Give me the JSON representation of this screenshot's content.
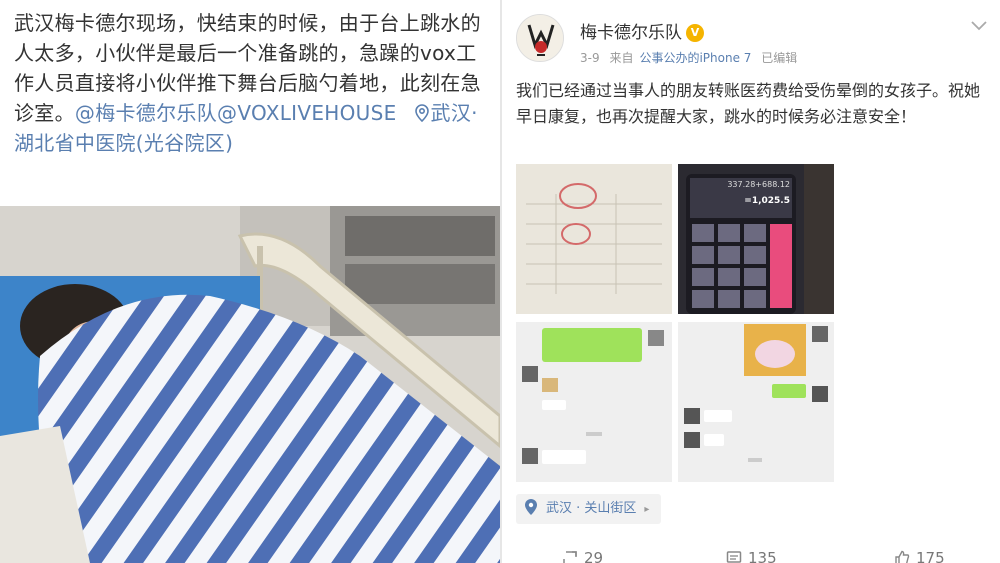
{
  "left_post": {
    "text_main": "武汉梅卡德尔现场，快结束的时候，由于台上跳水的人太多，小伙伴是最后一个准备跳的，急躁的vox工作人员直接将小伙伴推下舞台后脑勺着地，此刻在急诊室。",
    "mention_1": "@梅卡德尔乐队",
    "mention_2": "@VOXLIVEHOUSE",
    "location": "武汉·湖北省中医院(光谷院区)"
  },
  "right_post": {
    "author": "梅卡德尔乐队",
    "vip_badge": "V",
    "date": "3-9",
    "source_prefix": "来自",
    "source_device": "公事公办的iPhone 7",
    "edited": "已编辑",
    "text": "我们已经通过当事人的朋友转账医药费给受伤晕倒的女孩子。祝她早日康复，也再次提醒大家，跳水的时候务必注意安全！",
    "calculator_display": "337.28+688.12",
    "calculator_result": "=1,025.5",
    "location": "武汉 · 关山街区",
    "actions": {
      "repost_count": "29",
      "comment_count": "135",
      "like_count": "175"
    }
  },
  "colors": {
    "link": "#5a7fb0",
    "meta": "#999999",
    "calc_pink": "#e94c7d",
    "chat_green": "#9fe25b"
  },
  "icons": [
    "location-pin-icon",
    "chevron-down-icon",
    "repost-icon",
    "comment-icon",
    "like-icon",
    "vip-badge-icon"
  ]
}
